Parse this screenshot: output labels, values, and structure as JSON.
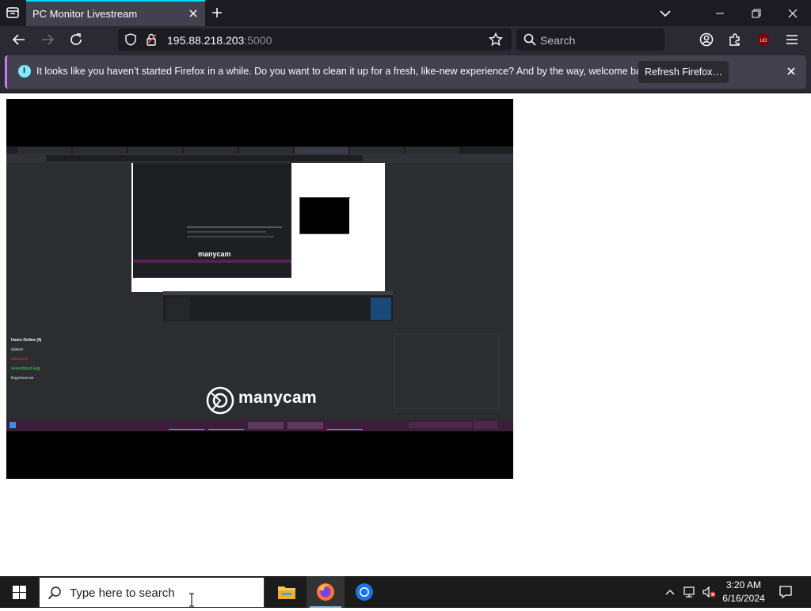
{
  "browser": {
    "tab_title": "PC Monitor Livestream",
    "url_host": "195.88.218.203",
    "url_port": ":5000",
    "search_placeholder": "Search"
  },
  "notification": {
    "message": "It looks like you haven’t started Firefox in a while. Do you want to clean it up for a fresh, like-new experience? And by the way, welcome back!",
    "button": "Refresh Firefox…"
  },
  "stream": {
    "users_title": "Users Online (4)",
    "users": [
      "dukeer",
      "tlobostein",
      "Greenblood Egg",
      "liegarheecas"
    ],
    "user_colors": [
      "#dddddd",
      "#e03030",
      "#3ddc54",
      "#dddddd"
    ],
    "overlay_brand": "manycam"
  },
  "taskbar": {
    "search_placeholder": "Type here to search",
    "time": "3:20 AM",
    "date": "6/16/2024"
  }
}
